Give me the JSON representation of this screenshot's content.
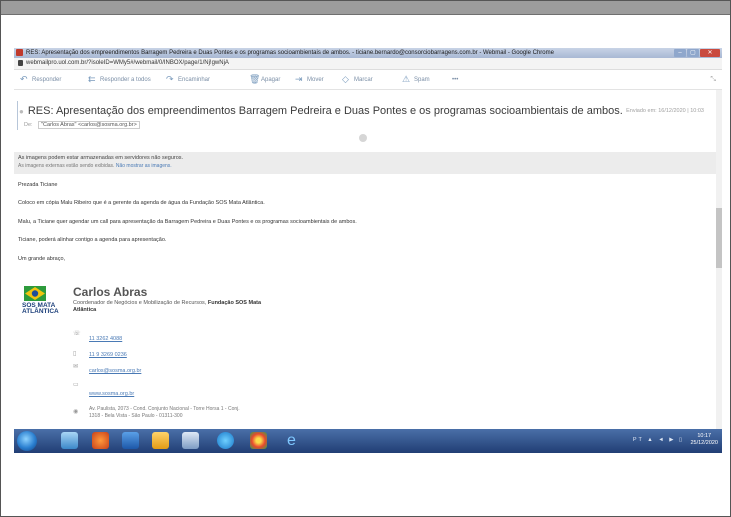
{
  "browser": {
    "title": "RES: Apresentação dos empreendimentos Barragem Pedreira e Duas Pontes e os programas socioambientais de ambos. - ticiane.bernardo@consorciobarragens.com.br - Webmail - Google Chrome",
    "url": "webmailpro.uol.com.br/?isoleID=WMy5#/webmail/0/INBOX/page/1/Nj!gwNjA"
  },
  "toolbar": {
    "reply": "Responder",
    "reply_all": "Responder a todos",
    "forward": "Encaminhar",
    "delete": "Apagar",
    "move": "Mover",
    "mark": "Marcar",
    "spam": "Spam",
    "more": "•••"
  },
  "message": {
    "subject": "RES: Apresentação dos empreendimentos Barragem Pedreira e Duas Pontes e os programas socioambientais de ambos.",
    "sent": "Enviado em: 16/12/2020 | 10:03",
    "from_label": "De:",
    "from": "\"Carlos Abras\" <carlos@sosma.org.br>"
  },
  "warning": {
    "line1": "As imagens podem estar armazenadas em servidores não seguros.",
    "line2": "As imagens externas estão sendo exibidas.",
    "link": "Não mostrar as imagens."
  },
  "body": {
    "greeting": "Prezada Ticiane",
    "p1": "Coloco em cópia Malu Ribeiro que é a gerente da agenda de água da Fundação SOS Mata Atlântica.",
    "p2": "Malu, a Ticiane quer agendar um call para apresentação da Barragem Pedreira e Duas Pontes e os programas socioambientais de ambos.",
    "p3": "Ticiane, poderá alinhar contigo a agenda para apresentação.",
    "closing": "Um grande abraço,"
  },
  "signature": {
    "logo_text": "SOS MATA ATLÂNTICA",
    "name": "Carlos Abras",
    "role_line1": "Coordenador de Negócios e Mobilização de Recursos,",
    "role_org": "Fundação SOS Mata",
    "role_line2": "Atlântica",
    "phone1": "11 3262 4088",
    "phone2": "11 9 3269 0236",
    "email": "carlos@sosma.org.br",
    "site": "www.sosma.org.br",
    "address1": "Av. Paulista, 2073 - Cond. Conjunto Nacional - Torre Horsa 1 - Conj.",
    "address2": "1318 - Bela Vista - São Paulo - 01311-300"
  },
  "taskbar": {
    "tray": "PT  ▲  ◄  ▶  ▯",
    "time": "10:17",
    "date": "25/12/2020"
  },
  "colors": {
    "taskbar": "#2b4f8a",
    "link": "#4a7ab5",
    "titlebar": "#b8c6de"
  }
}
